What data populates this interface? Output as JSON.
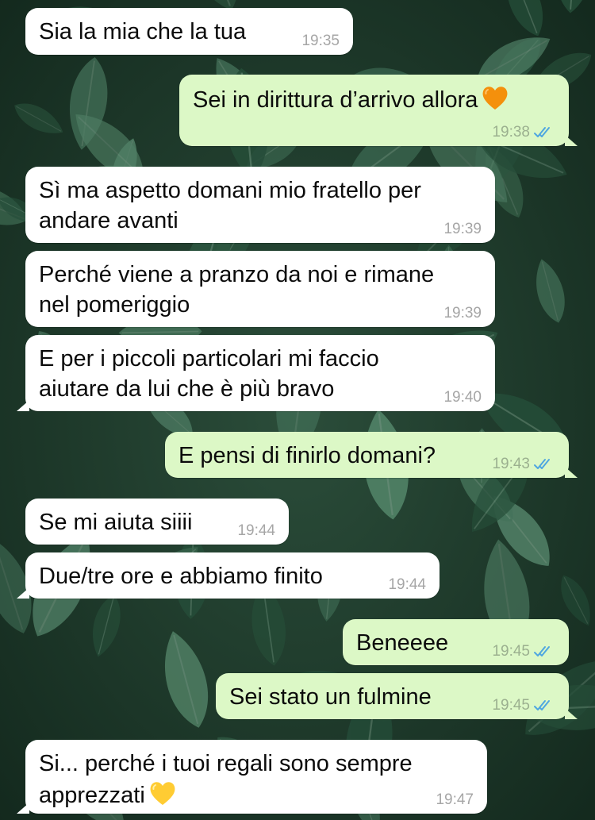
{
  "colors": {
    "incoming_bubble": "#ffffff",
    "outgoing_bubble": "#dcf8c6",
    "read_ticks": "#4fa7e0",
    "wallpaper": "#1d3a2b"
  },
  "icons": {
    "read_receipt": "double-check-icon",
    "orange_heart": "orange-heart-icon",
    "yellow_heart": "yellow-heart-icon"
  },
  "messages": [
    {
      "direction": "in",
      "text": "Sia la mia che la tua",
      "time": "19:35"
    },
    {
      "direction": "out",
      "text": "Sei in dirittura d’arrivo allora",
      "emoji": "orange-heart",
      "time": "19:38",
      "read": true
    },
    {
      "direction": "in",
      "text": "Sì ma aspetto domani mio fratello per\nandare avanti",
      "time": "19:39"
    },
    {
      "direction": "in",
      "text": "Perché viene a pranzo da noi e rimane\nnel pomeriggio",
      "time": "19:39"
    },
    {
      "direction": "in",
      "text": "E per i piccoli particolari mi faccio\naiutare da lui che è più bravo",
      "time": "19:40"
    },
    {
      "direction": "out",
      "text": "E pensi di finirlo domani?",
      "time": "19:43",
      "read": true
    },
    {
      "direction": "in",
      "text": "Se mi aiuta siiii",
      "time": "19:44"
    },
    {
      "direction": "in",
      "text": "Due/tre ore e abbiamo finito",
      "time": "19:44"
    },
    {
      "direction": "out",
      "text": "Beneeee",
      "time": "19:45",
      "read": true
    },
    {
      "direction": "out",
      "text": "Sei stato un fulmine",
      "time": "19:45",
      "read": true
    },
    {
      "direction": "in",
      "text": "Si... perché i tuoi regali sono sempre\napprezzati",
      "emoji": "yellow-heart",
      "time": "19:47"
    }
  ]
}
